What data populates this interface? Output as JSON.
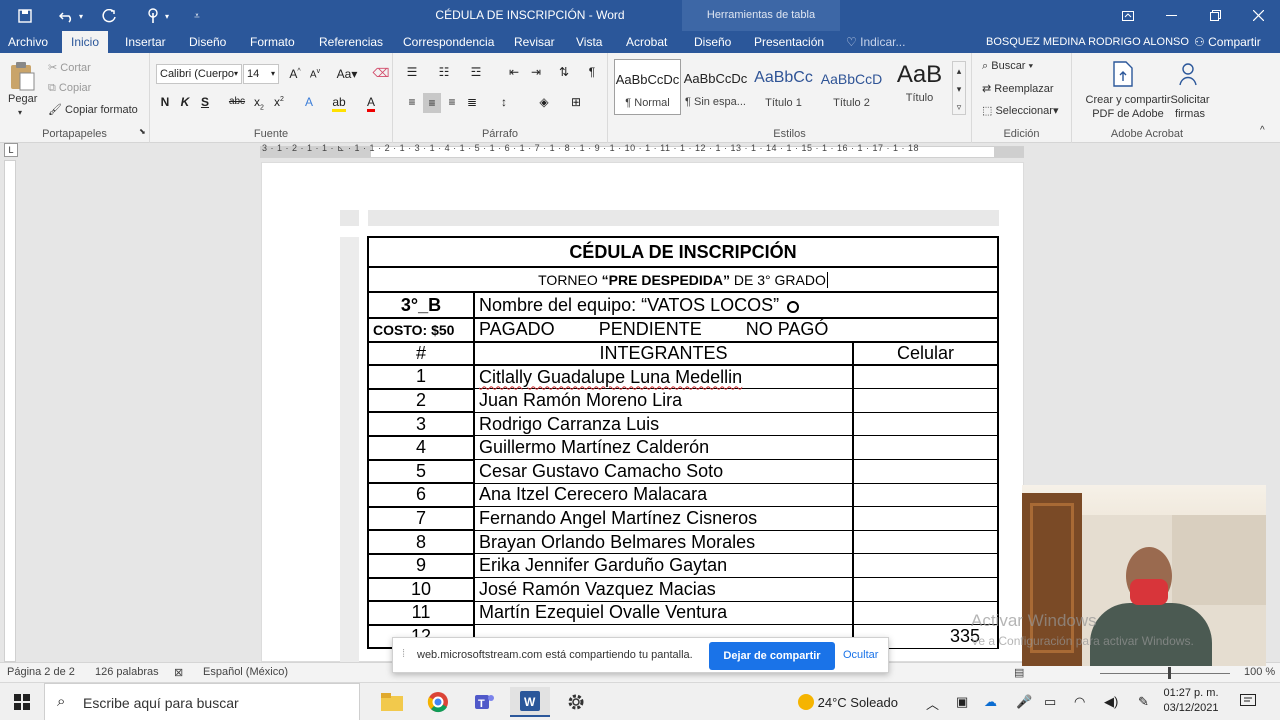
{
  "titlebar": {
    "document_title": "CÉDULA DE INSCRIPCIÓN  -  Word",
    "contextual_tools": "Herramientas de tabla",
    "quick_access": [
      "save-icon",
      "undo-icon",
      "redo-icon",
      "touch-mode-icon",
      "customize-icon"
    ]
  },
  "tabs": [
    "Archivo",
    "Inicio",
    "Insertar",
    "Diseño",
    "Formato",
    "Referencias",
    "Correspondencia",
    "Revisar",
    "Vista",
    "Acrobat",
    "Diseño",
    "Presentación"
  ],
  "tell_me": "Indicar...",
  "user_name": "BOSQUEZ MEDINA RODRIGO ALONSO",
  "share_label": "Compartir",
  "ribbon": {
    "clipboard": {
      "paste": "Pegar",
      "cut": "Cortar",
      "copy": "Copiar",
      "format_painter": "Copiar formato",
      "label": "Portapapeles"
    },
    "font": {
      "family": "Calibri (Cuerpo",
      "size": "14",
      "label": "Fuente"
    },
    "paragraph": {
      "label": "Párrafo"
    },
    "styles": {
      "items": [
        {
          "preview": "AaBbCcDc",
          "name": "¶ Normal"
        },
        {
          "preview": "AaBbCcDc",
          "name": "¶ Sin espa..."
        },
        {
          "preview": "AaBbCc",
          "name": "Título 1"
        },
        {
          "preview": "AaBbCcD",
          "name": "Título 2"
        },
        {
          "preview": "AaB",
          "name": "Título"
        }
      ],
      "label": "Estilos"
    },
    "editing": {
      "find": "Buscar",
      "replace": "Reemplazar",
      "select": "Seleccionar",
      "label": "Edición"
    },
    "acrobat": {
      "create": "Crear y compartir",
      "create2": "PDF de Adobe",
      "request": "Solicitar",
      "request2": "firmas",
      "label": "Adobe Acrobat"
    }
  },
  "ruler_numbers": "3 · 1 · 2 · 1 · 1 · ⊾ · 1 · 1 · 2 · 1 · 3 · 1 · 4 · 1 · 5 · 1 · 6 · 1 · 7 · 1 · 8 · 1 · 9 · 1 · 10 · 1 · 11 · 1 · 12 · 1 · 13 · 1 · 14 · 1 · 15 · 1 · 16 · 1 · 17 · 1 · 18",
  "document": {
    "title": "CÉDULA DE INSCRIPCIÓN",
    "subtitle_pre": "TORNEO ",
    "subtitle_bold": "“PRE DESPEDIDA”",
    "subtitle_post": " DE 3° GRADO",
    "group": "3°_B",
    "team": "Nombre del equipo: “VATOS LOCOS”",
    "cost": "COSTO: $50",
    "payment_options": [
      "PAGADO",
      "PENDIENTE",
      "NO PAGÓ"
    ],
    "col_num": "#",
    "col_members": "INTEGRANTES",
    "col_phone": "Celular",
    "members": [
      {
        "n": "1",
        "name": "Citlally Guadalupe Luna Medellin"
      },
      {
        "n": "2",
        "name": "Juan Ramón Moreno Lira"
      },
      {
        "n": "3",
        "name": "Rodrigo Carranza Luis"
      },
      {
        "n": "4",
        "name": "Guillermo Martínez Calderón"
      },
      {
        "n": "5",
        "name": "Cesar Gustavo Camacho Soto"
      },
      {
        "n": "6",
        "name": "Ana Itzel Cerecero Malacara"
      },
      {
        "n": "7",
        "name": "Fernando Angel Martínez Cisneros"
      },
      {
        "n": "8",
        "name": "Brayan Orlando Belmares Morales"
      },
      {
        "n": "9",
        "name": "Erika Jennifer Garduño Gaytan"
      },
      {
        "n": "10",
        "name": "José Ramón Vazquez Macias"
      },
      {
        "n": "11",
        "name": "Martín Ezequiel Ovalle Ventura"
      }
    ],
    "partial_row": {
      "n": "12",
      "phone_fragment": "335"
    }
  },
  "sharebar": {
    "message": "web.microsoftstream.com está compartiendo tu pantalla.",
    "stop": "Dejar de compartir",
    "hide": "Ocultar"
  },
  "watermark": {
    "line1": "Activar Windows",
    "line2": "Ve a Configuración para activar Windows."
  },
  "status": {
    "page": "Página 2 de 2",
    "words": "126 palabras",
    "language": "Español (México)",
    "zoom": "100 %"
  },
  "taskbar": {
    "search_placeholder": "Escribe aquí para buscar",
    "weather": "24°C  Soleado",
    "time": "01:27 p. m.",
    "date": "03/12/2021"
  },
  "colors": {
    "word_blue": "#2b579a",
    "share_blue": "#1a73e8",
    "spell_red": "#d13438"
  }
}
